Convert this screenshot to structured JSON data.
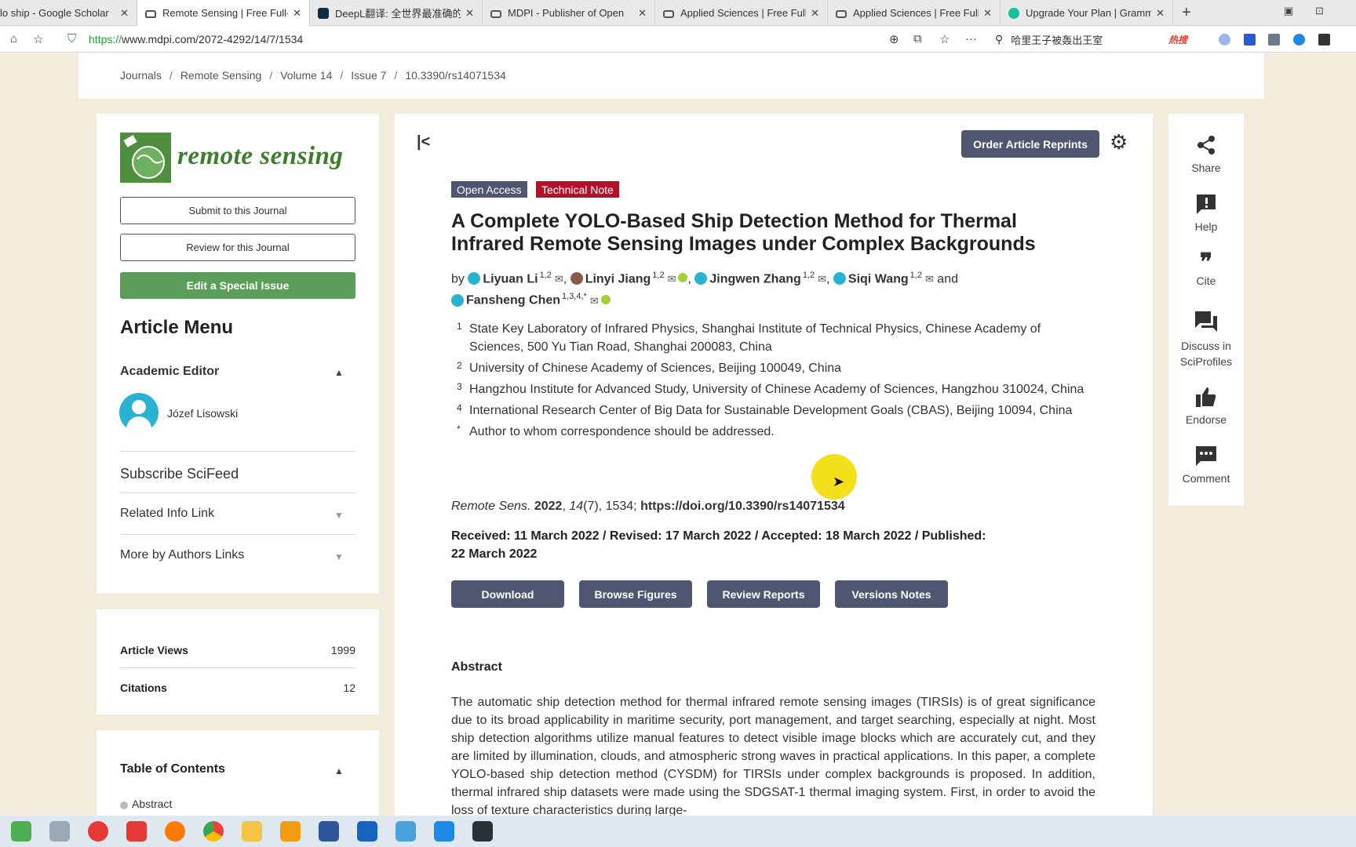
{
  "browser": {
    "tabs": [
      {
        "title": "lo ship - Google Scholar",
        "active": false,
        "color": "#4a7bd8"
      },
      {
        "title": "Remote Sensing | Free Full-",
        "active": true,
        "color": "#555555"
      },
      {
        "title": "DeepL翻译: 全世界最准确的",
        "active": false,
        "color": "#0f2b46"
      },
      {
        "title": "MDPI - Publisher of Open",
        "active": false,
        "color": "#555555"
      },
      {
        "title": "Applied Sciences | Free Full",
        "active": false,
        "color": "#555555"
      },
      {
        "title": "Applied Sciences | Free Full",
        "active": false,
        "color": "#555555"
      },
      {
        "title": "Upgrade Your Plan | Gramm",
        "active": false,
        "color": "#15c39a"
      }
    ],
    "url_scheme": "https://",
    "url_rest": "www.mdpi.com/2072-4292/14/7/1534",
    "search_text": "哈里王子被轰出王室",
    "hot_label": "热搜"
  },
  "breadcrumb": [
    "Journals",
    "Remote Sensing",
    "Volume 14",
    "Issue 7",
    "10.3390/rs14071534"
  ],
  "sidebar": {
    "journal_logo_text": "remote sensing",
    "submit_label": "Submit to this Journal",
    "review_label": "Review for this Journal",
    "special_issue_label": "Edit a Special Issue",
    "menu_title": "Article Menu",
    "academic_editor_label": "Academic Editor",
    "editor_name": "Józef Lisowski",
    "subscribe_label": "Subscribe SciFeed",
    "related_label": "Related Info Link",
    "more_label": "More by Authors Links",
    "views_label": "Article Views",
    "views_value": "1999",
    "citations_label": "Citations",
    "citations_value": "12",
    "toc_title": "Table of Contents",
    "toc_items": [
      "Abstract"
    ]
  },
  "article": {
    "reprint_label": "Order Article Reprints",
    "tag_open_access": "Open Access",
    "tag_type": "Technical Note",
    "title": "A Complete YOLO-Based Ship Detection Method for Thermal Infrared Remote Sensing Images under Complex Backgrounds",
    "by": "by",
    "authors": [
      {
        "name": "Liyuan Li",
        "sup": "1,2"
      },
      {
        "name": "Linyi Jiang",
        "sup": "1,2"
      },
      {
        "name": "Jingwen Zhang",
        "sup": "1,2"
      },
      {
        "name": "Siqi Wang",
        "sup": "1,2"
      },
      {
        "name": "Fansheng Chen",
        "sup": "1,3,4,*"
      }
    ],
    "and": "and",
    "affiliations": [
      {
        "num": "1",
        "text": "State Key Laboratory of Infrared Physics, Shanghai Institute of Technical Physics, Chinese Academy of Sciences, 500 Yu Tian Road, Shanghai 200083, China"
      },
      {
        "num": "2",
        "text": "University of Chinese Academy of Sciences, Beijing 100049, China"
      },
      {
        "num": "3",
        "text": "Hangzhou Institute for Advanced Study, University of Chinese Academy of Sciences, Hangzhou 310024, China"
      },
      {
        "num": "4",
        "text": "International Research Center of Big Data for Sustainable Development Goals (CBAS), Beijing 10094, China"
      },
      {
        "num": "*",
        "text": "Author to whom correspondence should be addressed."
      }
    ],
    "cite_journal": "Remote Sens.",
    "cite_year": "2022",
    "cite_volume": "14",
    "cite_issue_pages": "(7), 1534;",
    "doi": "https://doi.org/10.3390/rs14071534",
    "dates": "Received: 11 March 2022 / Revised: 17 March 2022 / Accepted: 18 March 2022 / Published: 22 March 2022",
    "buttons": [
      "Download",
      "Browse Figures",
      "Review Reports",
      "Versions Notes"
    ],
    "abstract_heading": "Abstract",
    "abstract_text": "The automatic ship detection method for thermal infrared remote sensing images (TIRSIs) is of great significance due to its broad applicability in maritime security, port management, and target searching, especially at night. Most ship detection algorithms utilize manual features to detect visible image blocks which are accurately cut, and they are limited by illumination, clouds, and atmospheric strong waves in practical applications. In this paper, a complete YOLO-based ship detection method (CYSDM) for TIRSIs under complex backgrounds is proposed. In addition, thermal infrared ship datasets were made using the SDGSAT-1 thermal imaging system. First, in order to avoid the loss of texture characteristics during large-"
  },
  "right_rail": [
    {
      "label": "Share",
      "icon": "share-icon"
    },
    {
      "label": "Help",
      "icon": "help-icon"
    },
    {
      "label": "Cite",
      "icon": "quote-icon"
    },
    {
      "label": "Discuss in SciProfiles",
      "icon": "discuss-icon"
    },
    {
      "label": "Endorse",
      "icon": "thumbs-up-icon"
    },
    {
      "label": "Comment",
      "icon": "comment-icon"
    }
  ],
  "colors": {
    "brand_dark": "#4f5671",
    "tag_red": "#b5102a",
    "green_button": "#5a9e5a",
    "page_bg": "#f3ecdc"
  }
}
